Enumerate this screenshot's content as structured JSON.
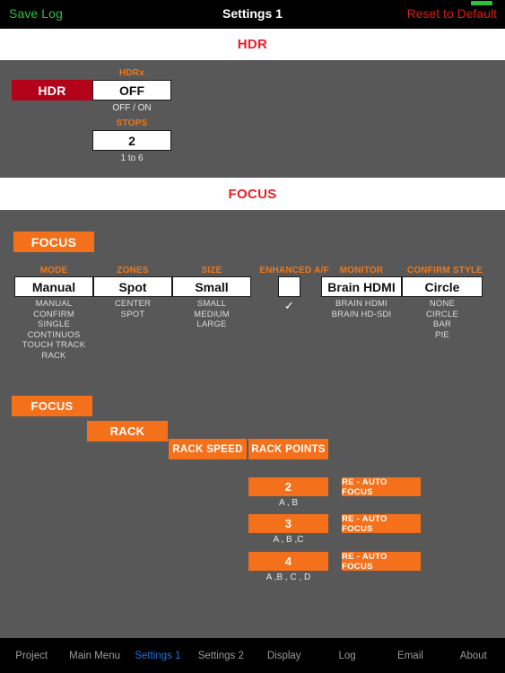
{
  "topbar": {
    "save_log": "Save Log",
    "title": "Settings 1",
    "reset": "Reset to Default",
    "status_pip": "battery-indicator"
  },
  "sections": {
    "hdr_band": "HDR",
    "focus_band": "FOCUS"
  },
  "hdr": {
    "button": "HDR",
    "hdrx_label": "HDRx",
    "hdrx_value": "OFF",
    "hdrx_hint": "OFF / ON",
    "stops_label": "STOPS",
    "stops_value": "2",
    "stops_hint": "1 to 6"
  },
  "focus": {
    "button": "FOCUS",
    "mode": {
      "label": "MODE",
      "value": "Manual",
      "options": "MANUAL\nCONFIRM\nSINGLE\nCONTINUOS\nTOUCH TRACK\nRACK"
    },
    "zones": {
      "label": "ZONES",
      "value": "Spot",
      "options": "CENTER\nSPOT"
    },
    "size": {
      "label": "SIZE",
      "value": "Small",
      "options": "SMALL\nMEDIUM\nLARGE"
    },
    "enhanced_af": {
      "label": "ENHANCED A/F",
      "value": "",
      "check": "✓"
    },
    "monitor": {
      "label": "MONITOR",
      "value": "Brain HDMI",
      "options": "BRAIN HDMI\nBRAIN HD-SDI"
    },
    "confirm_style": {
      "label": "CONFIRM STYLE",
      "value": "Circle",
      "options": "NONE\nCIRCLE\nBAR\nPIE"
    }
  },
  "rack": {
    "focus_button": "FOCUS",
    "rack_button": "RACK",
    "rack_speed_button": "RACK SPEED",
    "rack_points_button": "RACK POINTS",
    "rows": [
      {
        "count": "2",
        "caption": "A , B",
        "action": "RE - AUTO FOCUS"
      },
      {
        "count": "3",
        "caption": "A , B ,C",
        "action": "RE - AUTO FOCUS"
      },
      {
        "count": "4",
        "caption": "A ,B , C , D",
        "action": "RE - AUTO FOCUS"
      }
    ]
  },
  "tabs": [
    {
      "label": "Project",
      "active": false
    },
    {
      "label": "Main Menu",
      "active": false
    },
    {
      "label": "Settings 1",
      "active": true
    },
    {
      "label": "Settings 2",
      "active": false
    },
    {
      "label": "Display",
      "active": false
    },
    {
      "label": "Log",
      "active": false
    },
    {
      "label": "Email",
      "active": false
    },
    {
      "label": "About",
      "active": false
    }
  ],
  "colors": {
    "accent_orange": "#f4701a",
    "accent_red": "#ec1c24",
    "hdr_red": "#b3031b",
    "panel_gray": "#585858",
    "active_tab_blue": "#1f6fe0",
    "save_green": "#2fbf3f"
  }
}
